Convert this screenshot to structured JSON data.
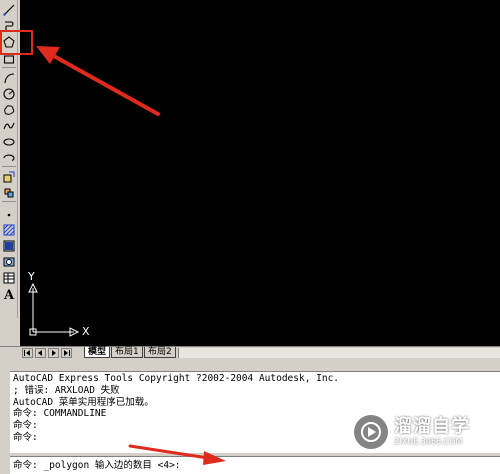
{
  "toolbar": {
    "tools": [
      {
        "name": "line-icon"
      },
      {
        "name": "construction-line-icon"
      },
      {
        "name": "polygon-icon"
      },
      {
        "name": "rectangle-icon"
      },
      {
        "name": "arc-icon"
      },
      {
        "name": "circle-icon"
      },
      {
        "name": "revision-cloud-icon"
      },
      {
        "name": "spline-icon"
      },
      {
        "name": "ellipse-icon"
      },
      {
        "name": "ellipse-arc-icon"
      },
      {
        "name": "insert-block-icon"
      },
      {
        "name": "make-block-icon"
      },
      {
        "name": "point-icon"
      },
      {
        "name": "hatch-icon"
      },
      {
        "name": "gradient-icon"
      },
      {
        "name": "region-icon"
      },
      {
        "name": "table-icon"
      },
      {
        "name": "multiline-text-icon"
      }
    ],
    "text_tool_label": "A"
  },
  "canvas": {
    "ucs_x_label": "X",
    "ucs_y_label": "Y"
  },
  "tabs": {
    "items": [
      {
        "label": "模型",
        "active": true
      },
      {
        "label": "布局1",
        "active": false
      },
      {
        "label": "布局2",
        "active": false
      }
    ]
  },
  "command_window": {
    "history": [
      "AutoCAD Express Tools Copyright ?2002-2004 Autodesk, Inc.",
      "; 错误: ARXLOAD 失败",
      "AutoCAD 菜单实用程序已加载。",
      "命令: COMMANDLINE",
      "命令:",
      "命令:"
    ],
    "prompt": "命令: _polygon 输入边的数目 <4>:"
  },
  "annotation": {
    "highlight_color": "#e02a1e",
    "arrow_color": "#e02a1e"
  },
  "watermark": {
    "title": "溜溜自学",
    "url": "ZIXUE.3066.COM"
  }
}
